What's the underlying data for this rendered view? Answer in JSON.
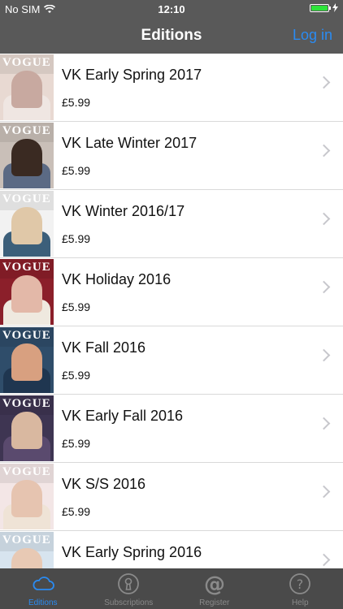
{
  "status_bar": {
    "carrier": "No SIM",
    "time": "12:10"
  },
  "nav": {
    "title": "Editions",
    "login_label": "Log in"
  },
  "editions": [
    {
      "name": "VK Early Spring 2017",
      "price": "£5.99",
      "cover_colors": [
        "#e8d9d2",
        "#c8a9a0",
        "#efe6e2"
      ]
    },
    {
      "name": "VK Late Winter 2017",
      "price": "£5.99",
      "cover_colors": [
        "#c9bfb8",
        "#3a2a22",
        "#5b6a84"
      ]
    },
    {
      "name": "VK Winter 2016/17",
      "price": "£5.99",
      "cover_colors": [
        "#f2f2f2",
        "#e0c8a8",
        "#3c5f7a"
      ]
    },
    {
      "name": "VK Holiday 2016",
      "price": "£5.99",
      "cover_colors": [
        "#8b1f2a",
        "#e3b8a8",
        "#efe9df"
      ]
    },
    {
      "name": "VK Fall 2016",
      "price": "£5.99",
      "cover_colors": [
        "#2f4d6a",
        "#d8a080",
        "#1f3650"
      ]
    },
    {
      "name": "VK Early Fall 2016",
      "price": "£5.99",
      "cover_colors": [
        "#3e3552",
        "#d9b8a0",
        "#5a4a6e"
      ]
    },
    {
      "name": "VK S/S 2016",
      "price": "£5.99",
      "cover_colors": [
        "#f3e6e6",
        "#e6c4b0",
        "#efe3d6"
      ]
    },
    {
      "name": "VK Early Spring 2016",
      "price": "",
      "cover_colors": [
        "#d7e4ef",
        "#e8c9b4",
        "#3a4f7a"
      ]
    }
  ],
  "tabs": [
    {
      "label": "Editions",
      "icon": "cloud-icon",
      "active": true
    },
    {
      "label": "Subscriptions",
      "icon": "keyhole-icon",
      "active": false
    },
    {
      "label": "Register",
      "icon": "at-sign-icon",
      "active": false
    },
    {
      "label": "Help",
      "icon": "question-icon",
      "active": false
    }
  ],
  "colors": {
    "accent": "#2a8bf2",
    "bars": "#595959",
    "tabbar": "#4a4a4a",
    "battery": "#2ee33b"
  }
}
